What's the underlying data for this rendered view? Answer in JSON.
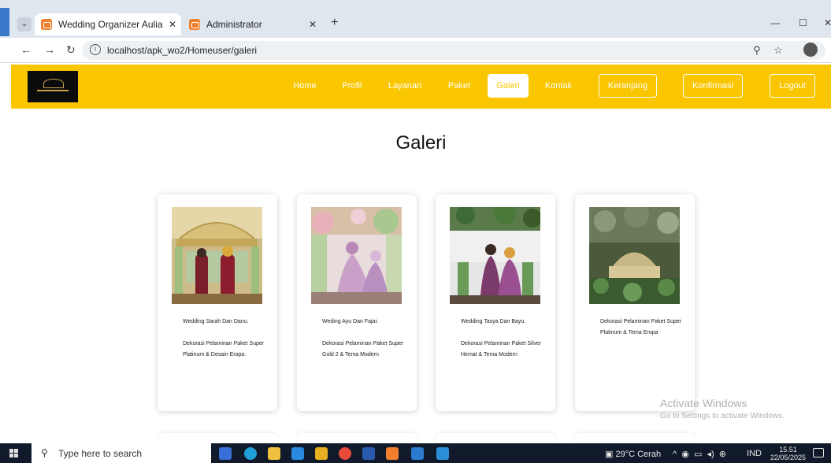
{
  "browser": {
    "tabs": [
      {
        "title": "Wedding Organizer Aulia",
        "active": true
      },
      {
        "title": "Administrator",
        "active": false
      }
    ],
    "url": "localhost/apk_wo2/Homeuser/galeri"
  },
  "header": {
    "nav": [
      "Home",
      "Profil",
      "Layanan",
      "Paket",
      "Galeri",
      "Kontak"
    ],
    "active_nav": "Galeri",
    "buttons": [
      "Keranjang",
      "Konfirmasi",
      "Logout"
    ]
  },
  "page": {
    "title": "Galeri",
    "cards": [
      {
        "name": "Wedding Sarah Dan Danu.",
        "desc": "Dekorasi Pelaminan Paket Super Platinum & Desain Eropa."
      },
      {
        "name": "Weding Ayu Dan Fajar.",
        "desc": "Dekorasi Pelaminan Paket Super Gold 2 & Tema Modern"
      },
      {
        "name": "Wedding Tasya Dan Bayu.",
        "desc": "Dekorasi Pelaminan Paket Silver Hemat & Tema Modern"
      },
      {
        "name": "",
        "desc": "Dekorasi Pelaminan Paket Super Platinum & Tema Eropa"
      }
    ]
  },
  "watermark": {
    "title": "Activate Windows",
    "subtitle": "Go to Settings to activate Windows."
  },
  "taskbar": {
    "search_placeholder": "Type here to search",
    "weather": "29°C  Cerah",
    "language": "IND",
    "time": "15.51",
    "date": "22/05/2025"
  },
  "colors": {
    "brand": "#f9c600",
    "taskbar": "#101a2a"
  }
}
